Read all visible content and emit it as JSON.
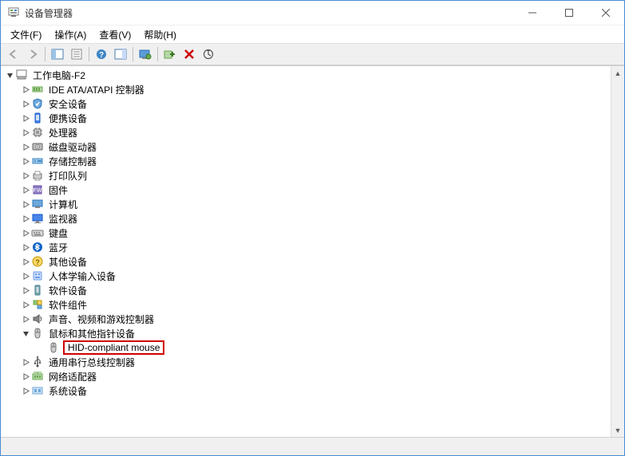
{
  "window": {
    "title": "设备管理器",
    "min_tip": "Minimize",
    "max_tip": "Maximize",
    "close_tip": "Close"
  },
  "menu": {
    "file": "文件(F)",
    "action": "操作(A)",
    "view": "查看(V)",
    "help": "帮助(H)"
  },
  "toolbar": {
    "back": "Back",
    "forward": "Forward",
    "show_hide": "Show/Hide Console Tree",
    "properties": "Properties",
    "help": "Help",
    "action_pane": "Action Pane",
    "scan": "Scan for hardware changes",
    "add_legacy": "Add legacy hardware",
    "uninstall": "Uninstall device",
    "update": "Update driver"
  },
  "tree": {
    "root": {
      "label": "工作电脑-F2",
      "icon": "computer-root-icon"
    },
    "categories": [
      {
        "label": "IDE ATA/ATAPI 控制器",
        "icon": "ide-icon"
      },
      {
        "label": "安全设备",
        "icon": "security-icon"
      },
      {
        "label": "便携设备",
        "icon": "portable-icon"
      },
      {
        "label": "处理器",
        "icon": "cpu-icon"
      },
      {
        "label": "磁盘驱动器",
        "icon": "disk-icon"
      },
      {
        "label": "存储控制器",
        "icon": "storage-icon"
      },
      {
        "label": "打印队列",
        "icon": "print-queue-icon"
      },
      {
        "label": "固件",
        "icon": "firmware-icon"
      },
      {
        "label": "计算机",
        "icon": "computer-icon"
      },
      {
        "label": "监视器",
        "icon": "monitor-icon"
      },
      {
        "label": "键盘",
        "icon": "keyboard-icon"
      },
      {
        "label": "蓝牙",
        "icon": "bluetooth-icon"
      },
      {
        "label": "其他设备",
        "icon": "other-icon"
      },
      {
        "label": "人体学输入设备",
        "icon": "hid-icon"
      },
      {
        "label": "软件设备",
        "icon": "software-device-icon"
      },
      {
        "label": "软件组件",
        "icon": "software-component-icon"
      },
      {
        "label": "声音、视频和游戏控制器",
        "icon": "sound-icon"
      },
      {
        "label": "鼠标和其他指针设备",
        "icon": "mouse-icon",
        "expanded": true,
        "children": [
          {
            "label": "HID-compliant mouse",
            "icon": "mouse-device-icon",
            "highlight": true
          }
        ]
      },
      {
        "label": "通用串行总线控制器",
        "icon": "usb-icon"
      },
      {
        "label": "网络适配器",
        "icon": "network-icon"
      },
      {
        "label": "系统设备",
        "icon": "system-icon"
      }
    ]
  }
}
